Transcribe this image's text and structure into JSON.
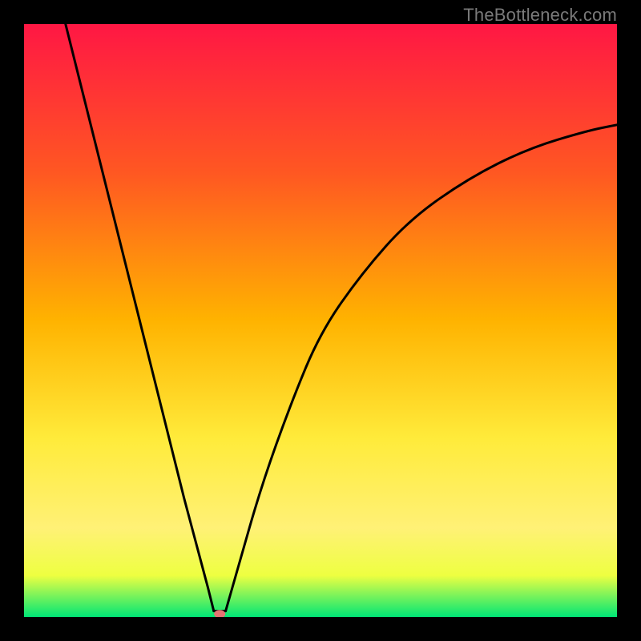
{
  "watermark": "TheBottleneck.com",
  "chart_data": {
    "type": "line",
    "title": "",
    "xlabel": "",
    "ylabel": "",
    "xlim": [
      0,
      100
    ],
    "ylim": [
      0,
      100
    ],
    "grid": false,
    "legend": false,
    "gradient_stops": [
      {
        "y": 0,
        "color": "#ff1744"
      },
      {
        "y": 25,
        "color": "#ff5722"
      },
      {
        "y": 50,
        "color": "#ffb300"
      },
      {
        "y": 70,
        "color": "#ffeb3b"
      },
      {
        "y": 85,
        "color": "#fff176"
      },
      {
        "y": 93,
        "color": "#eeff41"
      },
      {
        "y": 100,
        "color": "#00e676"
      }
    ],
    "curve_left": [
      {
        "x": 7,
        "y": 100
      },
      {
        "x": 12,
        "y": 80
      },
      {
        "x": 17,
        "y": 60
      },
      {
        "x": 22,
        "y": 40
      },
      {
        "x": 27,
        "y": 20
      },
      {
        "x": 31,
        "y": 5
      },
      {
        "x": 32,
        "y": 1
      }
    ],
    "curve_right": [
      {
        "x": 34,
        "y": 1
      },
      {
        "x": 36,
        "y": 8
      },
      {
        "x": 40,
        "y": 22
      },
      {
        "x": 45,
        "y": 36
      },
      {
        "x": 50,
        "y": 48
      },
      {
        "x": 57,
        "y": 58
      },
      {
        "x": 65,
        "y": 67
      },
      {
        "x": 75,
        "y": 74
      },
      {
        "x": 85,
        "y": 79
      },
      {
        "x": 95,
        "y": 82
      },
      {
        "x": 100,
        "y": 83
      }
    ],
    "marker": {
      "x": 33,
      "y": 0.5,
      "color": "#e57373"
    }
  }
}
